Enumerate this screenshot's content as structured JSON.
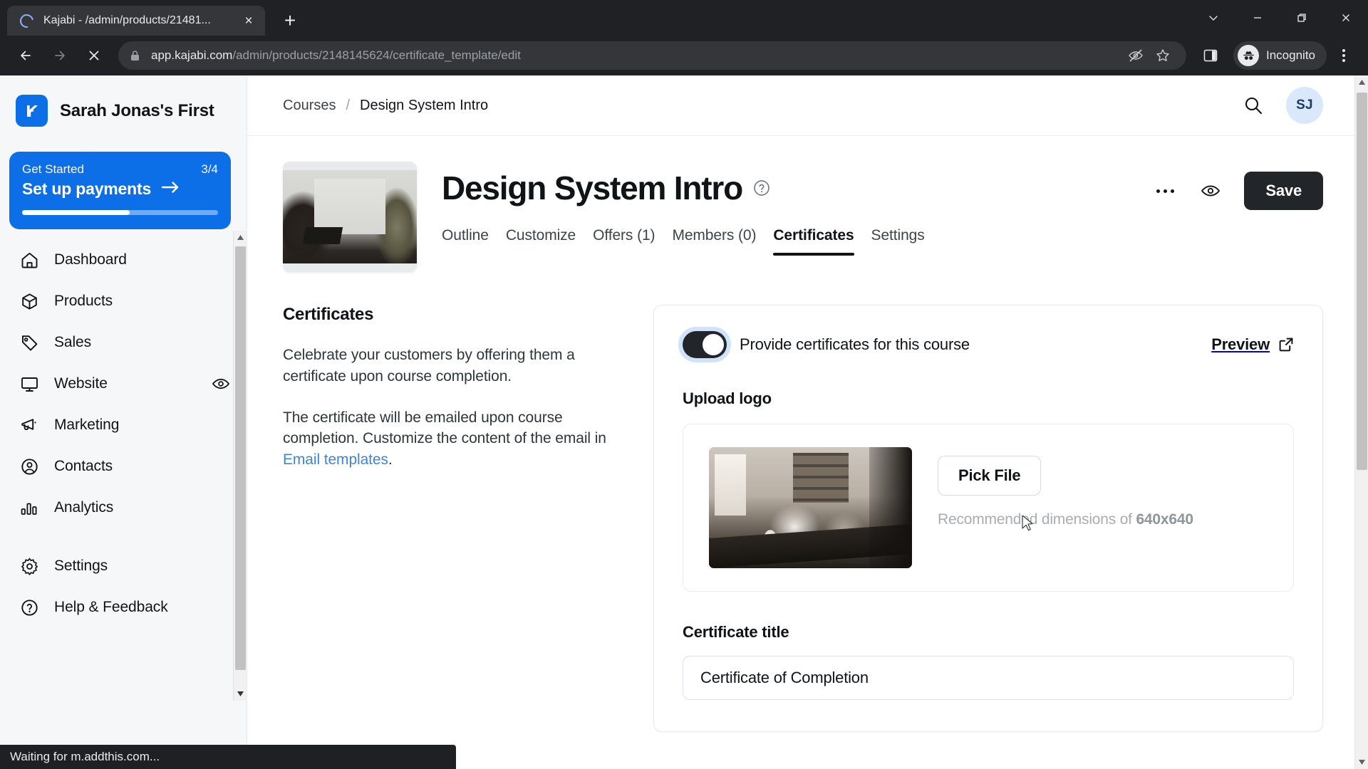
{
  "browser": {
    "tab": {
      "title": "Kajabi - /admin/products/21481...",
      "close_label": "×",
      "spinner": "loading-spinner"
    },
    "new_tab_label": "+",
    "window_controls": {
      "minimize_group": "chevron-down",
      "minimize": "minimize",
      "maximize": "maximize",
      "close": "close"
    },
    "nav": {
      "back": "back-arrow",
      "forward": "forward-arrow",
      "stop": "stop-x"
    },
    "url_domain": "app.kajabi.com",
    "url_path": "/admin/products/2148145624/certificate_template/edit",
    "omnibox_icons": [
      "third-party-cookie-blocked",
      "bookmark-star"
    ],
    "side_panel": "side-panel",
    "profile_label": "Incognito",
    "menu": "three-dot-menu",
    "status_text": "Waiting for m.addthis.com..."
  },
  "sidebar": {
    "brand_name": "Sarah Jonas's First",
    "get_started": {
      "label": "Get Started",
      "count": "3/4",
      "action": "Set up payments",
      "arrow": "→",
      "progress_percent": 55
    },
    "items": [
      {
        "label": "Dashboard",
        "icon": "home-icon"
      },
      {
        "label": "Products",
        "icon": "box-icon"
      },
      {
        "label": "Sales",
        "icon": "tag-icon"
      },
      {
        "label": "Website",
        "icon": "monitor-icon",
        "trailing_icon": "eye-icon"
      },
      {
        "label": "Marketing",
        "icon": "megaphone-icon"
      },
      {
        "label": "Contacts",
        "icon": "person-circle-icon"
      },
      {
        "label": "Analytics",
        "icon": "bar-chart-icon"
      },
      {
        "label": "Settings",
        "icon": "gear-icon"
      },
      {
        "label": "Help & Feedback",
        "icon": "question-circle-icon"
      }
    ]
  },
  "topbar": {
    "breadcrumb": {
      "parent": "Courses",
      "separator": "/",
      "current": "Design System Intro"
    },
    "search_icon": "search-icon",
    "avatar_initials": "SJ"
  },
  "header": {
    "title": "Design System Intro",
    "help_icon": "question-mark-circle-icon",
    "thumbnail": "course-thumbnail",
    "tabs": [
      {
        "label": "Outline",
        "active": false
      },
      {
        "label": "Customize",
        "active": false
      },
      {
        "label": "Offers (1)",
        "active": false
      },
      {
        "label": "Members (0)",
        "active": false
      },
      {
        "label": "Certificates",
        "active": true
      },
      {
        "label": "Settings",
        "active": false
      }
    ],
    "more_actions": "ellipsis-icon",
    "preview_eye": "eye-icon",
    "save_label": "Save"
  },
  "left_panel": {
    "heading": "Certificates",
    "paragraph1": "Celebrate your customers by offering them a certificate upon course completion.",
    "paragraph2_before": "The certificate will be emailed upon course completion. Customize the content of the email in ",
    "paragraph2_link": "Email templates",
    "paragraph2_after": "."
  },
  "card": {
    "toggle": {
      "label": "Provide certificates for this course",
      "enabled": true
    },
    "preview": {
      "label": "Preview",
      "icon": "external-link-icon"
    },
    "upload_logo_label": "Upload logo",
    "logo_preview": "uploaded-logo-image",
    "pick_file_label": "Pick File",
    "recommended_prefix": "Recommended dimensions of ",
    "recommended_value": "640x640",
    "certificate_title_label": "Certificate title",
    "certificate_title_value": "Certificate of Completion"
  },
  "colors": {
    "accent_blue": "#0c6fe8",
    "link_blue": "#3f84d8",
    "dark": "#22262a",
    "chrome_bg": "#202124",
    "sidebar_bg": "#f6f7f8"
  }
}
